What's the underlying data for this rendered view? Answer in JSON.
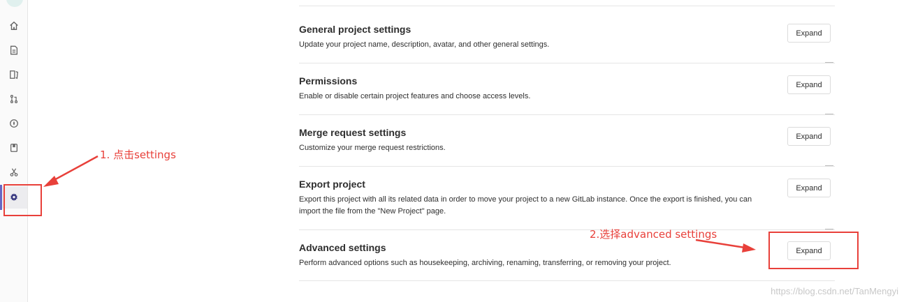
{
  "sidebar": {
    "icons": [
      "home-icon",
      "file-icon",
      "board-icon",
      "merge-request-icon",
      "rocket-icon",
      "book-icon",
      "snippet-icon",
      "gear-icon"
    ]
  },
  "sections": [
    {
      "title": "General project settings",
      "description": "Update your project name, description, avatar, and other general settings.",
      "button": "Expand"
    },
    {
      "title": "Permissions",
      "description": "Enable or disable certain project features and choose access levels.",
      "button": "Expand"
    },
    {
      "title": "Merge request settings",
      "description": "Customize your merge request restrictions.",
      "button": "Expand"
    },
    {
      "title": "Export project",
      "description": "Export this project with all its related data in order to move your project to a new GitLab instance. Once the export is finished, you can import the file from the \"New Project\" page.",
      "button": "Expand"
    },
    {
      "title": "Advanced settings",
      "description": "Perform advanced options such as housekeeping, archiving, renaming, transferring, or removing your project.",
      "button": "Expand"
    }
  ],
  "annotations": {
    "step1": "1. 点击settings",
    "step2": "2.选择advanced settings",
    "color": "#e8403a"
  },
  "watermark": "https://blog.csdn.net/TanMengyi"
}
